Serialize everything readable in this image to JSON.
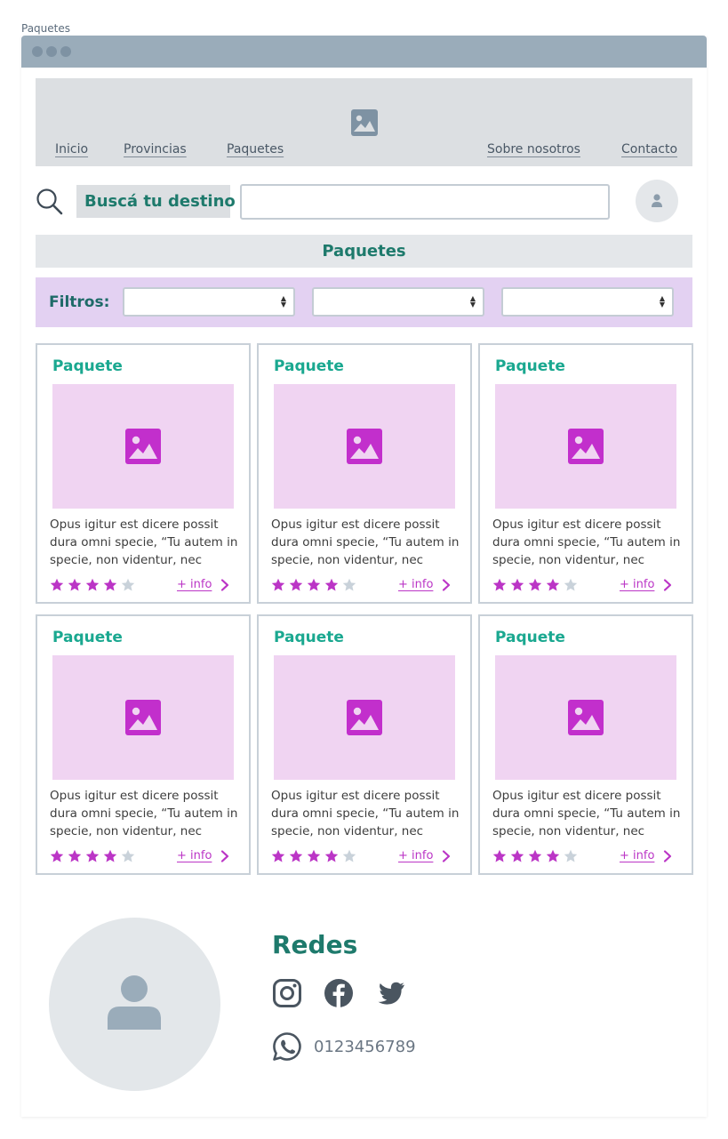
{
  "page_label": "Paquetes",
  "nav": {
    "items": [
      {
        "label": "Inicio"
      },
      {
        "label": "Provincias"
      },
      {
        "label": "Paquetes"
      },
      {
        "label": "Sobre nosotros"
      },
      {
        "label": "Contacto"
      }
    ]
  },
  "search": {
    "label": "Buscá tu destino",
    "value": "",
    "placeholder": ""
  },
  "section": {
    "title": "Paquetes"
  },
  "filters": {
    "label": "Filtros:",
    "selects": [
      "",
      "",
      ""
    ]
  },
  "cards": [
    {
      "title": "Paquete",
      "text": "Opus igitur est dicere possit dura omni specie, “Tu autem in specie, non videntur, nec",
      "rating": 4,
      "max_rating": 5,
      "link": "+ info"
    },
    {
      "title": "Paquete",
      "text": "Opus igitur est dicere possit dura omni specie, “Tu autem in specie, non videntur, nec",
      "rating": 4,
      "max_rating": 5,
      "link": "+ info"
    },
    {
      "title": "Paquete",
      "text": "Opus igitur est dicere possit dura omni specie, “Tu autem in specie, non videntur, nec",
      "rating": 4,
      "max_rating": 5,
      "link": "+ info"
    },
    {
      "title": "Paquete",
      "text": "Opus igitur est dicere possit dura omni specie, “Tu autem in specie, non videntur, nec",
      "rating": 4,
      "max_rating": 5,
      "link": "+ info"
    },
    {
      "title": "Paquete",
      "text": "Opus igitur est dicere possit dura omni specie, “Tu autem in specie, non videntur, nec",
      "rating": 4,
      "max_rating": 5,
      "link": "+ info"
    },
    {
      "title": "Paquete",
      "text": "Opus igitur est dicere possit dura omni specie, “Tu autem in specie, non videntur, nec",
      "rating": 4,
      "max_rating": 5,
      "link": "+ info"
    }
  ],
  "footer": {
    "title": "Redes",
    "social_icons": [
      "instagram-icon",
      "facebook-icon",
      "twitter-icon"
    ],
    "phone": "0123456789"
  },
  "colors": {
    "accent_green": "#1e7a6c",
    "card_title": "#1aa890",
    "magenta": "#bb35c6",
    "star_filled": "#bb35c6",
    "star_empty": "#c9d2da",
    "filters_bg": "#e3d1f2"
  }
}
